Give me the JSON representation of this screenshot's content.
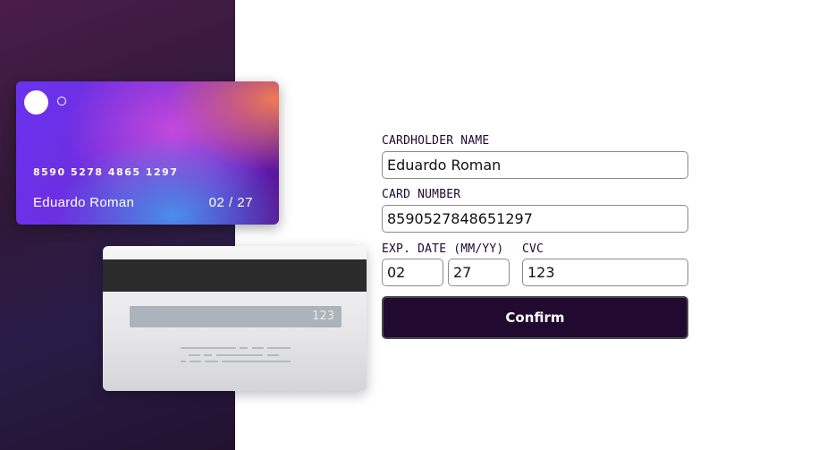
{
  "card_front": {
    "number": "8590 5278 4865 1297",
    "holder": "Eduardo Roman",
    "expiry": "02 / 27"
  },
  "card_back": {
    "cvc": "123"
  },
  "form": {
    "cardholder_label": "CARDHOLDER NAME",
    "cardholder_value": "Eduardo Roman",
    "number_label": "CARD NUMBER",
    "number_value": "8590527848651297",
    "exp_label": "EXP. DATE (MM/YY)",
    "exp_month": "02",
    "exp_year": "27",
    "cvc_label": "CVC",
    "cvc_value": "123",
    "confirm_label": "Confirm"
  },
  "colors": {
    "accent_dark": "#21092f",
    "side_background": "#2f1838"
  }
}
